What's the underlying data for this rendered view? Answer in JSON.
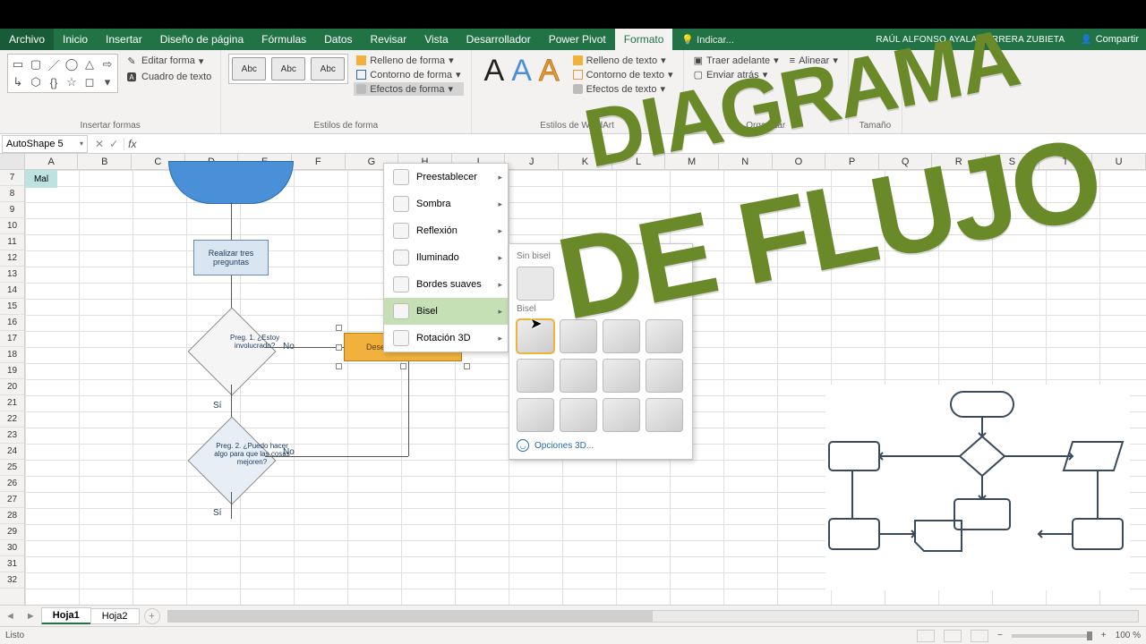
{
  "titlebar": {
    "file": "Archivo",
    "tabs": [
      "Inicio",
      "Insertar",
      "Diseño de página",
      "Fórmulas",
      "Datos",
      "Revisar",
      "Vista",
      "Desarrollador",
      "Power Pivot",
      "Formato"
    ],
    "active_tab": "Formato",
    "tell_me": "Indicar...",
    "user": "RAÚL ALFONSO AYALA HERRERA ZUBIETA",
    "share": "Compartir"
  },
  "ribbon": {
    "insert_shapes": {
      "edit_shape": "Editar forma",
      "text_box": "Cuadro de texto",
      "label": "Insertar formas"
    },
    "shape_styles": {
      "sample": "Abc",
      "fill": "Relleno de forma",
      "outline": "Contorno de forma",
      "effects": "Efectos de forma",
      "label": "Estilos de forma"
    },
    "wordart": {
      "label": "Estilos de WordArt"
    },
    "text": {
      "fill": "Relleno de texto",
      "outline": "Contorno de texto",
      "effects": "Efectos de texto"
    },
    "arrange": {
      "bring_forward": "Traer adelante",
      "send_backward": "Enviar atrás",
      "align": "Alinear",
      "label": "Organizar"
    },
    "size": {
      "label": "Tamaño"
    }
  },
  "namebox": "AutoShape 5",
  "columns": [
    "A",
    "B",
    "C",
    "D",
    "E",
    "F",
    "G",
    "H",
    "I",
    "J",
    "K",
    "L",
    "M",
    "N",
    "O",
    "P",
    "Q",
    "R",
    "S",
    "T",
    "U"
  ],
  "row_start": 7,
  "row_end": 32,
  "flow": {
    "process1": "Realizar tres preguntas",
    "decision1": "Preg. 1. ¿Estoy involucrado?",
    "decision2": "Preg. 2. ¿Puedo hacer algo para que las cosas mejoren?",
    "selected": "Desechar El Chisme",
    "no": "No",
    "si": "Sí",
    "mal": "Mal"
  },
  "effects_menu": {
    "items": [
      "Preestablecer",
      "Sombra",
      "Reflexión",
      "Iluminado",
      "Bordes suaves",
      "Bisel",
      "Rotación 3D"
    ],
    "active": "Bisel"
  },
  "bevel_flyout": {
    "no_bevel": "Sin bisel",
    "bevel": "Bisel",
    "options3d": "Opciones 3D..."
  },
  "sheets": {
    "tabs": [
      "Hoja1",
      "Hoja2"
    ],
    "active": "Hoja1"
  },
  "status": {
    "mode": "Listo",
    "zoom": "100 %"
  },
  "overlay": {
    "line1": "DIAGRAMA",
    "line2": "DE FLUJO"
  }
}
